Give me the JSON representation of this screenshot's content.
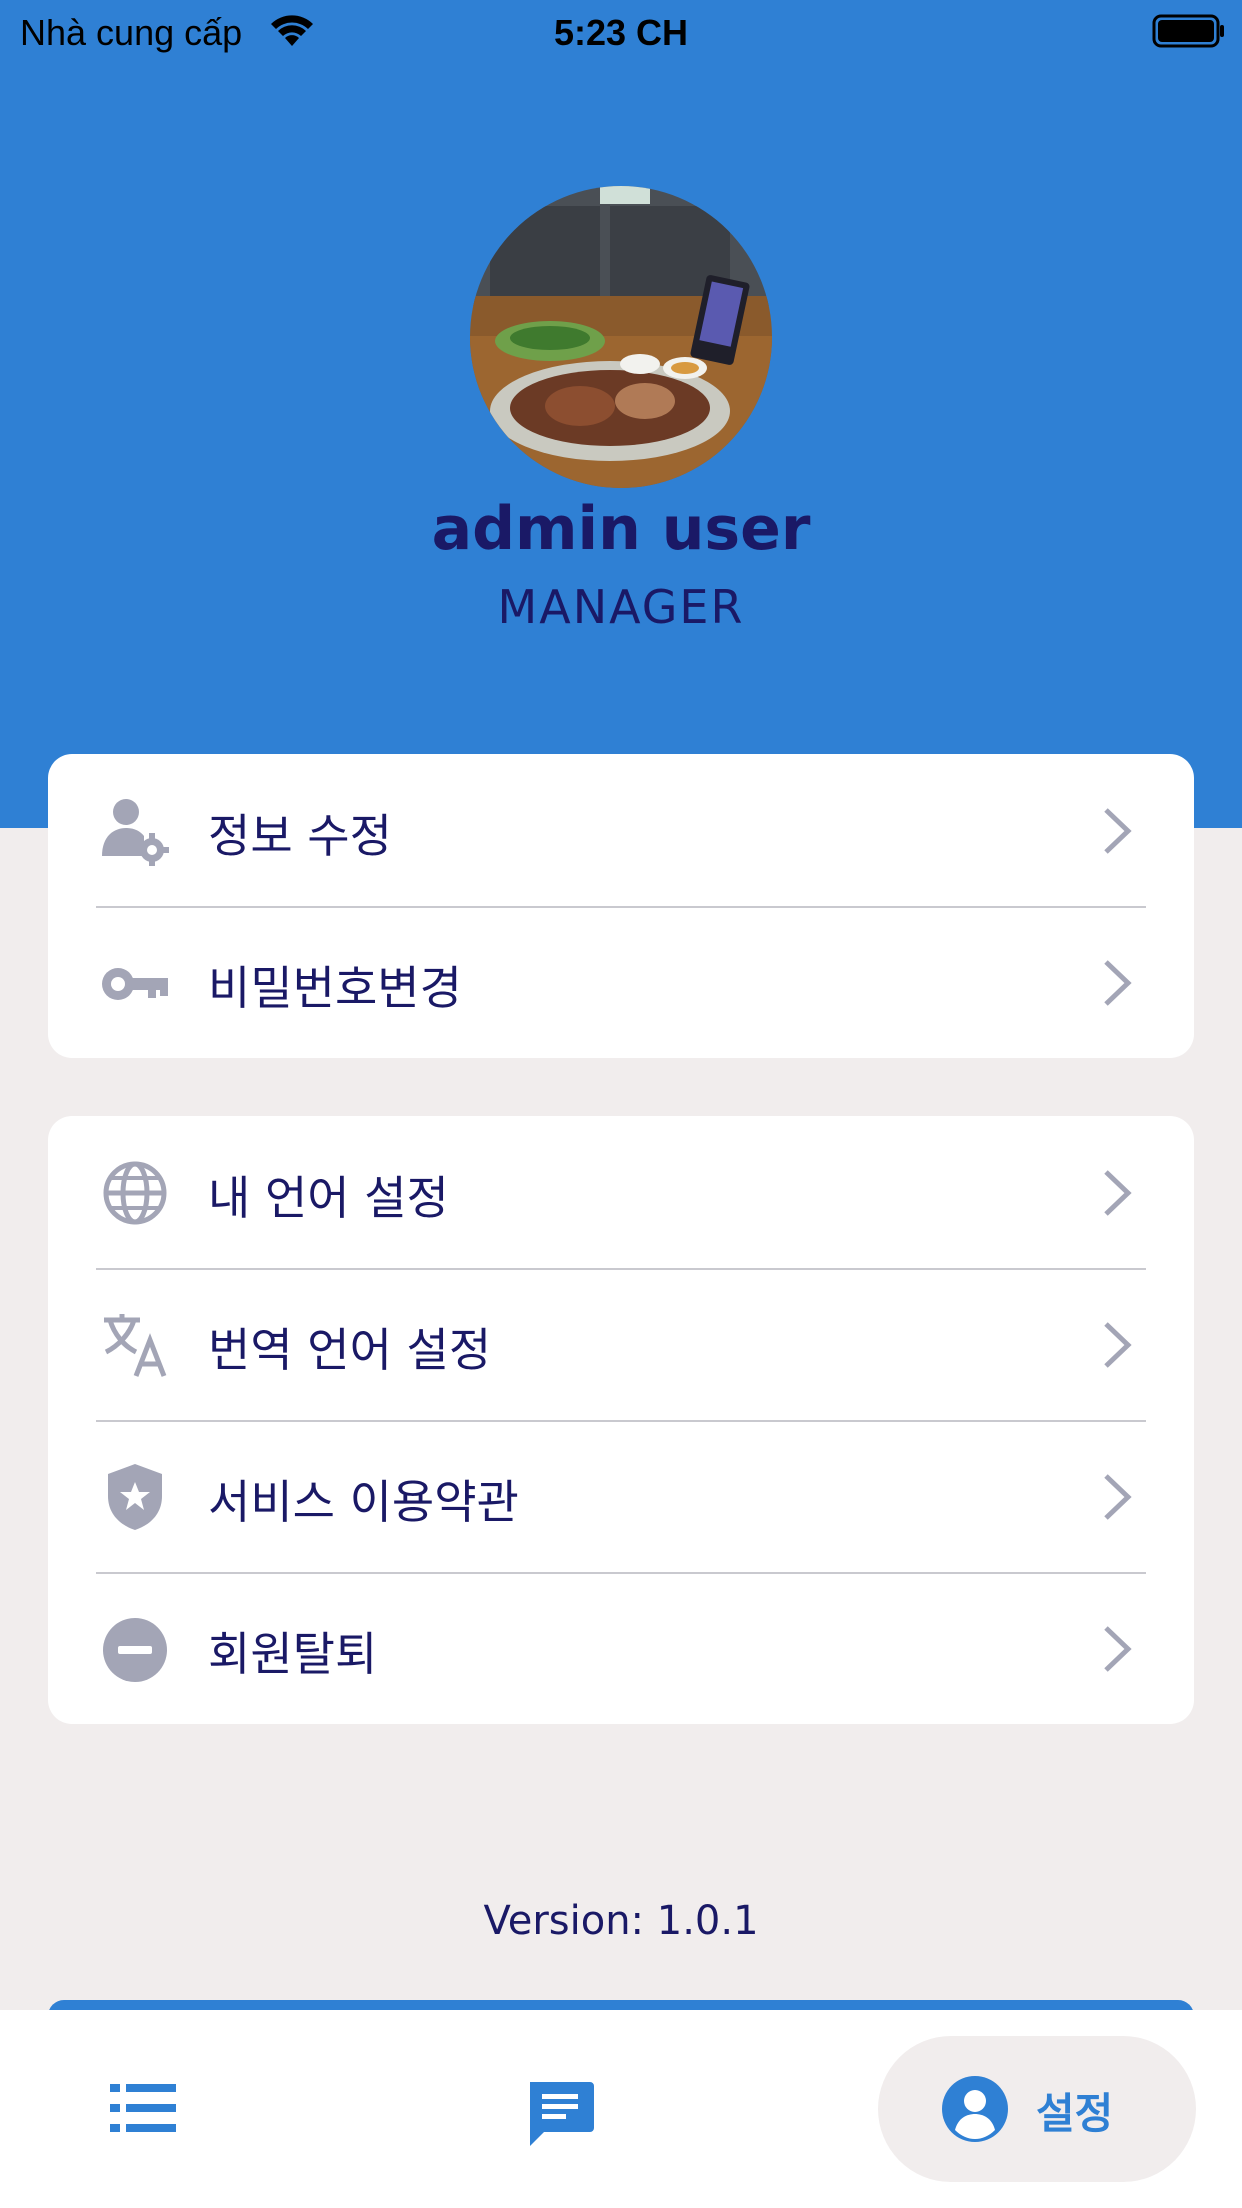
{
  "status_bar": {
    "carrier": "Nhà cung cấp",
    "time": "5:23 CH"
  },
  "profile": {
    "name": "admin user",
    "role": "MANAGER"
  },
  "account_menu": [
    {
      "label": "정보 수정",
      "icon": "user-gear-icon"
    },
    {
      "label": "비밀번호변경",
      "icon": "key-icon"
    }
  ],
  "settings_menu": [
    {
      "label": "내 언어 설정",
      "icon": "globe-icon"
    },
    {
      "label": "번역 언어 설정",
      "icon": "translate-icon"
    },
    {
      "label": "서비스 이용약관",
      "icon": "shield-star-icon"
    },
    {
      "label": "회원탈퇴",
      "icon": "minus-circle-icon"
    }
  ],
  "version": "Version: 1.0.1",
  "tabbar": {
    "tabs": [
      {
        "icon": "list-icon"
      },
      {
        "icon": "chat-icon"
      },
      {
        "icon": "account-icon",
        "label": "설정",
        "active": true
      }
    ]
  },
  "colors": {
    "primary": "#2f80d4",
    "text": "#1a1966",
    "icon": "#a3a5b6",
    "background": "#f1eded"
  }
}
